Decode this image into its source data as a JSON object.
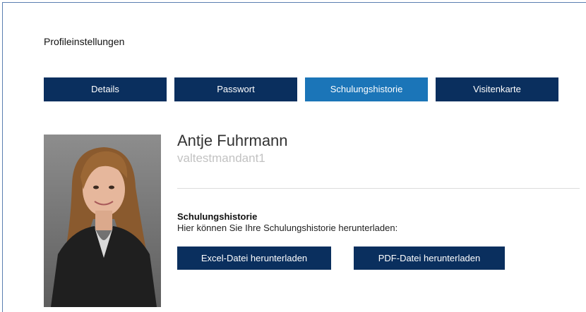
{
  "page": {
    "title": "Profileinstellungen"
  },
  "tabs": [
    {
      "label": "Details",
      "active": false
    },
    {
      "label": "Passwort",
      "active": false
    },
    {
      "label": "Schulungshistorie",
      "active": true
    },
    {
      "label": "Visitenkarte",
      "active": false
    }
  ],
  "profile": {
    "name": "Antje Fuhrmann",
    "tenant": "valtestmandant1"
  },
  "training_history": {
    "heading": "Schulungshistorie",
    "description": "Hier können Sie Ihre Schulungshistorie herunterladen:",
    "excel_button": "Excel-Datei herunterladen",
    "pdf_button": "PDF-Datei herunterladen"
  },
  "colors": {
    "tab_dark": "#0a2f5e",
    "tab_active": "#1b75b8",
    "tenant_text": "#c2c2c2"
  },
  "icons": {
    "avatar": "profile-photo"
  }
}
